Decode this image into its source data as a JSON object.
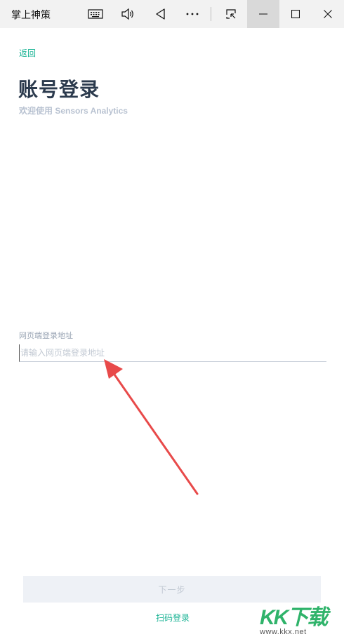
{
  "window": {
    "title": "掌上神策",
    "buttons": [
      "keyboard-icon",
      "volume-icon",
      "back-triangle-icon",
      "more-icon",
      "snap-icon",
      "minimize-icon",
      "maximize-icon",
      "close-icon"
    ]
  },
  "page": {
    "back_label": "返回",
    "title": "账号登录",
    "subtitle": "欢迎使用 Sensors Analytics"
  },
  "form": {
    "url_label": "网页端登录地址",
    "url_placeholder": "请输入网页端登录地址",
    "url_value": ""
  },
  "actions": {
    "next_label": "下一步",
    "qr_login_label": "扫码登录"
  },
  "watermark": {
    "mark": "KK下载",
    "url": "www.kkx.net"
  },
  "colors": {
    "accent": "#1ab394",
    "title": "#2b3a4d",
    "subtitle": "#b8c2d1",
    "button_bg": "#eef1f6",
    "arrow": "#e84a4a"
  }
}
